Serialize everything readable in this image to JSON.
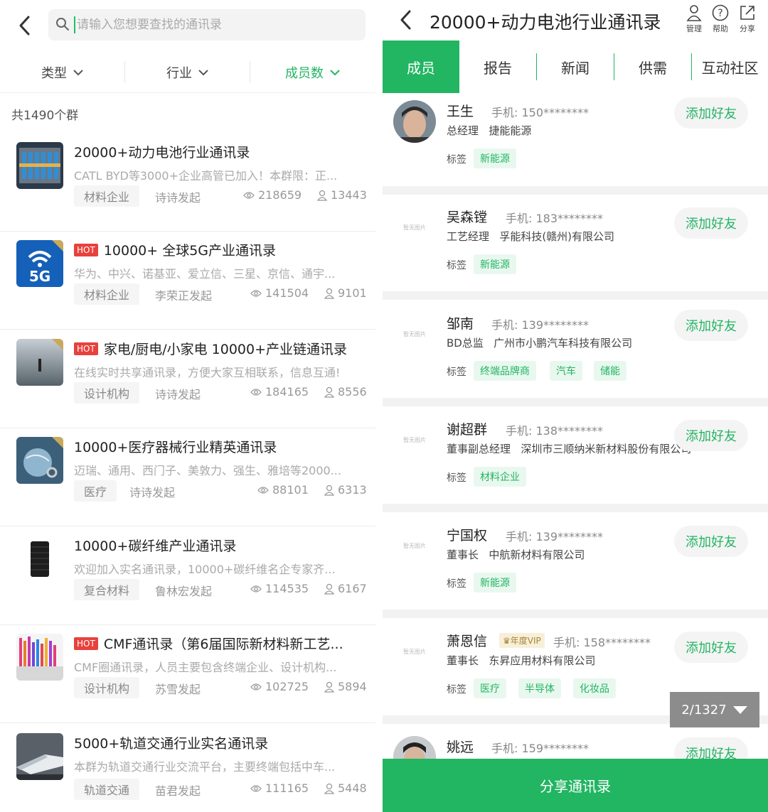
{
  "left": {
    "search": {
      "placeholder": "请输入您想要查找的通讯录"
    },
    "filters": [
      {
        "label": "类型"
      },
      {
        "label": "行业"
      },
      {
        "label": "成员数"
      }
    ],
    "count_label": "共1490个群",
    "items": [
      {
        "title": "20000+动力电池行业通讯录",
        "hot": false,
        "desc": "CATL BYD等3000+企业高管已加入！本群限：正...",
        "tag": "材料企业",
        "author": "诗诗发起",
        "views": "218659",
        "members": "13443"
      },
      {
        "title": "10000+ 全球5G产业通讯录",
        "hot": true,
        "hot_label": "HOT",
        "desc": "华为、中兴、诺基亚、爱立信、三星、京信、通宇...",
        "tag": "材料企业",
        "author": "李荣正发起",
        "views": "141504",
        "members": "9101"
      },
      {
        "title": "家电/厨电/小家电 10000+产业链通讯录",
        "hot": true,
        "hot_label": "HOT",
        "desc": "在线实时共享通讯录，方便大家互相联系，信息互通!",
        "tag": "设计机构",
        "author": "诗诗发起",
        "views": "184165",
        "members": "8556"
      },
      {
        "title": "10000+医疗器械行业精英通讯录",
        "hot": false,
        "desc": "迈瑞、通用、西门子、美敦力、强生、雅培等2000...",
        "tag": "医疗",
        "author": "诗诗发起",
        "views": "88101",
        "members": "6313"
      },
      {
        "title": "10000+碳纤维产业通讯录",
        "hot": false,
        "desc": "欢迎加入实名通讯录，10000+碳纤维名企专家齐...",
        "tag": "复合材料",
        "author": "鲁林宏发起",
        "views": "114535",
        "members": "6167"
      },
      {
        "title": "CMF通讯录（第6届国际新材料新工艺...",
        "hot": true,
        "hot_label": "HOT",
        "desc": "CMF圈通讯录，人员主要包含终端企业、设计机构...",
        "tag": "设计机构",
        "author": "苏雪发起",
        "views": "102725",
        "members": "5894"
      },
      {
        "title": "5000+轨道交通行业实名通讯录",
        "hot": false,
        "desc": "本群为轨道交通行业交流平台，主要终端包括中车...",
        "tag": "轨道交通",
        "author": "苗君发起",
        "views": "111165",
        "members": "5448"
      }
    ]
  },
  "right": {
    "title": "20000+动力电池行业通讯录",
    "actions": [
      {
        "label": "管理"
      },
      {
        "label": "帮助"
      },
      {
        "label": "分享"
      }
    ],
    "tabs": [
      {
        "label": "成员"
      },
      {
        "label": "报告"
      },
      {
        "label": "新闻"
      },
      {
        "label": "供需"
      },
      {
        "label": "互动社区"
      }
    ],
    "phone_label": "手机:",
    "tags_label": "标签",
    "add_label": "添加好友",
    "no_image_label": "暂无图片",
    "vip_label": "年度VIP",
    "members": [
      {
        "name": "王生",
        "phone": "150********",
        "role": "总经理",
        "company": "捷能能源",
        "tags": [
          "新能源"
        ]
      },
      {
        "name": "吴森镗",
        "phone": "183********",
        "role": "工艺经理",
        "company": "孚能科技(赣州)有限公司",
        "tags": [
          "新能源"
        ]
      },
      {
        "name": "邹南",
        "phone": "139********",
        "role": "BD总监",
        "company": "广州市小鹏汽车科技有限公司",
        "tags": [
          "终端品牌商",
          "汽车",
          "储能"
        ]
      },
      {
        "name": "谢超群",
        "phone": "138********",
        "role": "董事副总经理",
        "company": "深圳市三顺纳米新材料股份有限公司",
        "tags": [
          "材料企业"
        ]
      },
      {
        "name": "宁国权",
        "phone": "139********",
        "role": "董事长",
        "company": "中航新材料有限公司",
        "tags": [
          "新能源"
        ]
      },
      {
        "name": "萧恩信",
        "phone": "158********",
        "role": "董事长",
        "company": "东昇应用材料有限公司",
        "tags": [
          "医疗",
          "半导体",
          "化妆品"
        ]
      },
      {
        "name": "姚远",
        "phone": "159********"
      }
    ],
    "pager": "2/1327",
    "share_label": "分享通讯录"
  },
  "colors": {
    "accent": "#22b562",
    "hot": "#e8413c"
  }
}
